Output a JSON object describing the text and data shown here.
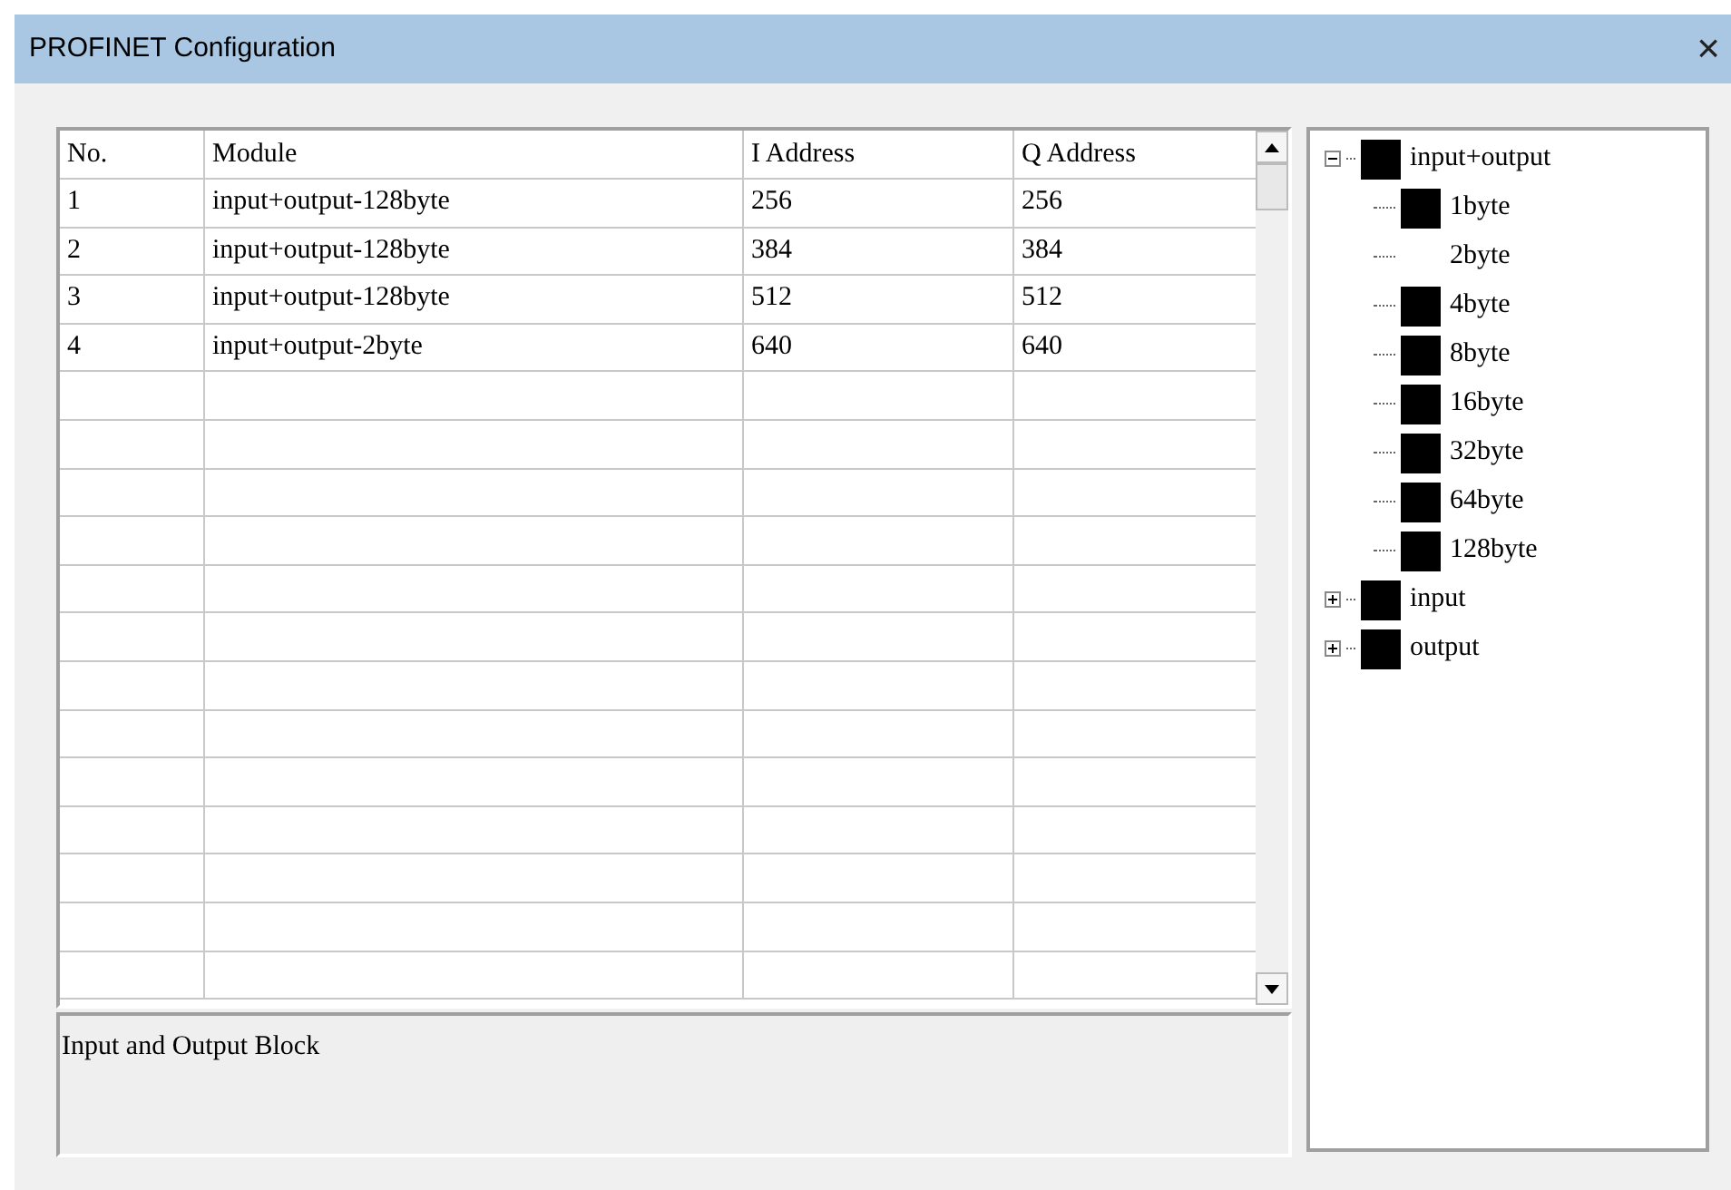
{
  "window": {
    "title": "PROFINET Configuration",
    "close": "×"
  },
  "table": {
    "columns": [
      "No.",
      "Module",
      "I Address",
      "Q Address"
    ],
    "rows": [
      {
        "cells": [
          "1",
          "input+output-128byte",
          "256",
          "256"
        ]
      },
      {
        "cells": [
          "2",
          "input+output-128byte",
          "384",
          "384"
        ]
      },
      {
        "cells": [
          "3",
          "input+output-128byte",
          "512",
          "512"
        ]
      },
      {
        "cells": [
          "4",
          "input+output-2byte",
          "640",
          "640"
        ]
      }
    ]
  },
  "description": "Input and Output Block",
  "tree": [
    {
      "label": "input+output",
      "expanded": true,
      "icon": true,
      "children": [
        {
          "label": "1byte",
          "icon": true
        },
        {
          "label": "2byte",
          "icon": false
        },
        {
          "label": "4byte",
          "icon": true
        },
        {
          "label": "8byte",
          "icon": true
        },
        {
          "label": "16byte",
          "icon": true
        },
        {
          "label": "32byte",
          "icon": true
        },
        {
          "label": "64byte",
          "icon": true
        },
        {
          "label": "128byte",
          "icon": true
        }
      ]
    },
    {
      "label": "input",
      "expanded": false,
      "icon": true
    },
    {
      "label": "output",
      "expanded": false,
      "icon": true
    }
  ]
}
